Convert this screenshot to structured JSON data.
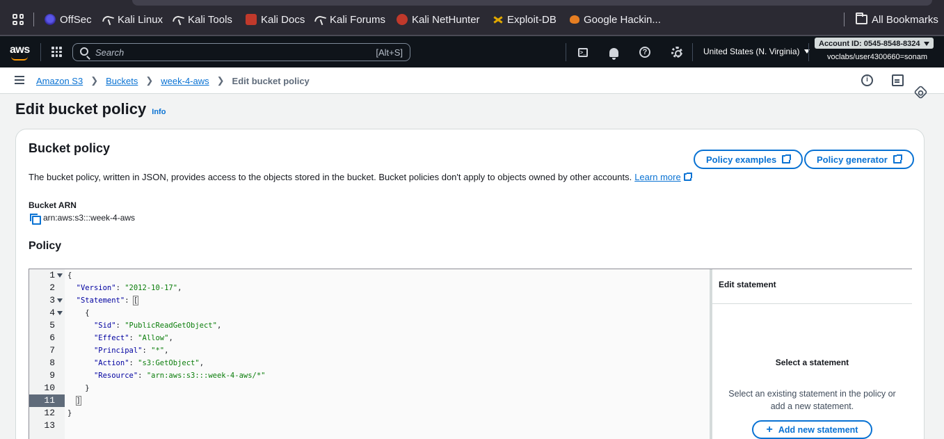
{
  "browser": {
    "bookmarks": [
      {
        "label": "OffSec",
        "icon": "offsec-icon"
      },
      {
        "label": "Kali Linux",
        "icon": "kali-dragon-icon"
      },
      {
        "label": "Kali Tools",
        "icon": "kali-dragon-icon"
      },
      {
        "label": "Kali Docs",
        "icon": "kali-docs-icon"
      },
      {
        "label": "Kali Forums",
        "icon": "kali-dragon-icon"
      },
      {
        "label": "Kali NetHunter",
        "icon": "nethunter-icon"
      },
      {
        "label": "Exploit-DB",
        "icon": "exploit-db-icon"
      },
      {
        "label": "Google Hackin...",
        "icon": "ghdb-icon"
      }
    ],
    "all_bookmarks": "All Bookmarks"
  },
  "aws_nav": {
    "logo": "aws",
    "search_placeholder": "Search",
    "search_shortcut": "[Alt+S]",
    "region": "United States (N. Virginia)",
    "account": "Account ID: 0545-8548-8324",
    "user": "voclabs/user4300660=sonam"
  },
  "breadcrumb": {
    "items": [
      "Amazon S3",
      "Buckets",
      "week-4-aws"
    ],
    "current": "Edit bucket policy"
  },
  "page": {
    "title": "Edit bucket policy",
    "info": "Info"
  },
  "bucket_policy": {
    "title": "Bucket policy",
    "description": "The bucket policy, written in JSON, provides access to the objects stored in the bucket. Bucket policies don't apply to objects owned by other accounts.",
    "learn_more": "Learn more",
    "policy_examples": "Policy examples",
    "policy_generator": "Policy generator",
    "arn_label": "Bucket ARN",
    "arn_value": "arn:aws:s3:::week-4-aws",
    "policy_label": "Policy"
  },
  "editor": {
    "line_numbers": [
      "1",
      "2",
      "3",
      "4",
      "5",
      "6",
      "7",
      "8",
      "9",
      "10",
      "11",
      "12",
      "13"
    ],
    "active_line": "11",
    "code": {
      "l1": "{",
      "l2_key": "\"Version\"",
      "l2_val": "\"2012-10-17\"",
      "l3_key": "\"Statement\"",
      "l3_open": "[",
      "l4": "{",
      "l5_key": "\"Sid\"",
      "l5_val": "\"PublicReadGetObject\"",
      "l6_key": "\"Effect\"",
      "l6_val": "\"Allow\"",
      "l7_key": "\"Principal\"",
      "l7_val": "\"*\"",
      "l8_key": "\"Action\"",
      "l8_val": "\"s3:GetObject\"",
      "l9_key": "\"Resource\"",
      "l9_val": "\"arn:aws:s3:::week-4-aws/*\"",
      "l10": "}",
      "l11": "]",
      "l12": "}"
    }
  },
  "side_panel": {
    "header": "Edit statement",
    "title": "Select a statement",
    "text": "Select an existing statement in the policy or add a new statement.",
    "add_button": "Add new statement"
  }
}
